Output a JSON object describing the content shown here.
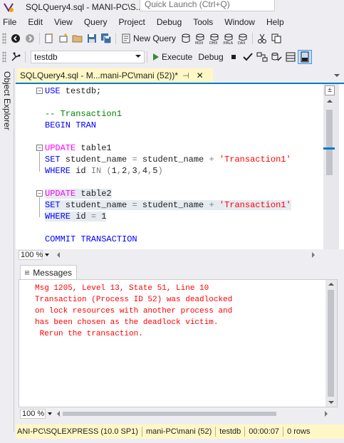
{
  "window": {
    "title": "SQLQuery4.sql - MANI-PC\\S...",
    "quick_launch_placeholder": "Quick Launch (Ctrl+Q)"
  },
  "menu": [
    "File",
    "Edit",
    "View",
    "Query",
    "Project",
    "Debug",
    "Tools",
    "Window",
    "Help"
  ],
  "toolbar1": {
    "new_query_label": "New Query",
    "icons": [
      "back-icon",
      "forward-icon",
      "new-project-icon",
      "add-item-icon",
      "open-icon",
      "save-icon",
      "save-all-icon",
      "new-query-icon",
      "database-engine-query-icon",
      "mdx-icon",
      "dmx-icon",
      "xmla-icon",
      "dax-icon",
      "cut-icon",
      "copy-icon"
    ]
  },
  "toolbar2": {
    "database": "testdb",
    "execute_label": "Execute",
    "debug_label": "Debug"
  },
  "side_panel": {
    "label": "Object Explorer"
  },
  "document_tab": {
    "label": "SQLQuery4.sql - M...mani-PC\\mani (52))*"
  },
  "editor": {
    "lines": [
      {
        "parts": [
          {
            "t": "USE",
            "c": "kw"
          },
          {
            "t": " testdb;",
            "c": ""
          }
        ]
      },
      {
        "parts": []
      },
      {
        "parts": [
          {
            "t": "-- Transaction1",
            "c": "cmt"
          }
        ]
      },
      {
        "parts": [
          {
            "t": "BEGIN TRAN",
            "c": "kw"
          }
        ]
      },
      {
        "parts": []
      },
      {
        "parts": [
          {
            "t": "UPDATE",
            "c": "mag"
          },
          {
            "t": " table1",
            "c": ""
          }
        ]
      },
      {
        "parts": [
          {
            "t": "SET",
            "c": "kw"
          },
          {
            "t": " student_name ",
            "c": ""
          },
          {
            "t": "=",
            "c": "gray"
          },
          {
            "t": " student_name ",
            "c": ""
          },
          {
            "t": "+",
            "c": "gray"
          },
          {
            "t": " ",
            "c": ""
          },
          {
            "t": "'Transaction1'",
            "c": "str"
          }
        ]
      },
      {
        "parts": [
          {
            "t": "WHERE",
            "c": "kw"
          },
          {
            "t": " id ",
            "c": ""
          },
          {
            "t": "IN",
            "c": "gray"
          },
          {
            "t": " ",
            "c": ""
          },
          {
            "t": "(",
            "c": "gray"
          },
          {
            "t": "1",
            "c": ""
          },
          {
            "t": ",",
            "c": "gray"
          },
          {
            "t": "2",
            "c": ""
          },
          {
            "t": ",",
            "c": "gray"
          },
          {
            "t": "3",
            "c": ""
          },
          {
            "t": ",",
            "c": "gray"
          },
          {
            "t": "4",
            "c": ""
          },
          {
            "t": ",",
            "c": "gray"
          },
          {
            "t": "5",
            "c": ""
          },
          {
            "t": ")",
            "c": "gray"
          }
        ]
      },
      {
        "parts": []
      },
      {
        "parts": [
          {
            "t": "UPDATE",
            "c": "mag"
          },
          {
            "t": " table2",
            "c": ""
          }
        ],
        "sel": true
      },
      {
        "parts": [
          {
            "t": "SET",
            "c": "kw"
          },
          {
            "t": " student_name ",
            "c": ""
          },
          {
            "t": "=",
            "c": "gray"
          },
          {
            "t": " student_name ",
            "c": ""
          },
          {
            "t": "+",
            "c": "gray"
          },
          {
            "t": " ",
            "c": ""
          },
          {
            "t": "'Transaction1'",
            "c": "str"
          }
        ],
        "sel": true
      },
      {
        "parts": [
          {
            "t": "WHERE",
            "c": "kw"
          },
          {
            "t": " id ",
            "c": ""
          },
          {
            "t": "=",
            "c": "gray"
          },
          {
            "t": " 1",
            "c": ""
          }
        ],
        "sel": true
      },
      {
        "parts": []
      },
      {
        "parts": [
          {
            "t": "COMMIT TRANSACTION",
            "c": "kw"
          }
        ]
      }
    ]
  },
  "editor_zoom": "100 %",
  "results": {
    "tab_label": "Messages",
    "messages": [
      "Msg 1205, Level 13, State 51, Line 10",
      "Transaction (Process ID 52) was deadlocked",
      "on lock resources with another process and",
      "has been chosen as the deadlock victim.",
      " Rerun the transaction."
    ],
    "zoom": "100 %"
  },
  "statusbar": {
    "server": "ANI-PC\\SQLEXPRESS (10.0 SP1)",
    "user": "mani-PC\\mani (52)",
    "database": "testdb",
    "elapsed": "00:00:07",
    "rows": "0 rows"
  },
  "colors": {
    "accent": "#007acc",
    "statusbar": "#fff8c6",
    "error_text": "#ff0000"
  }
}
